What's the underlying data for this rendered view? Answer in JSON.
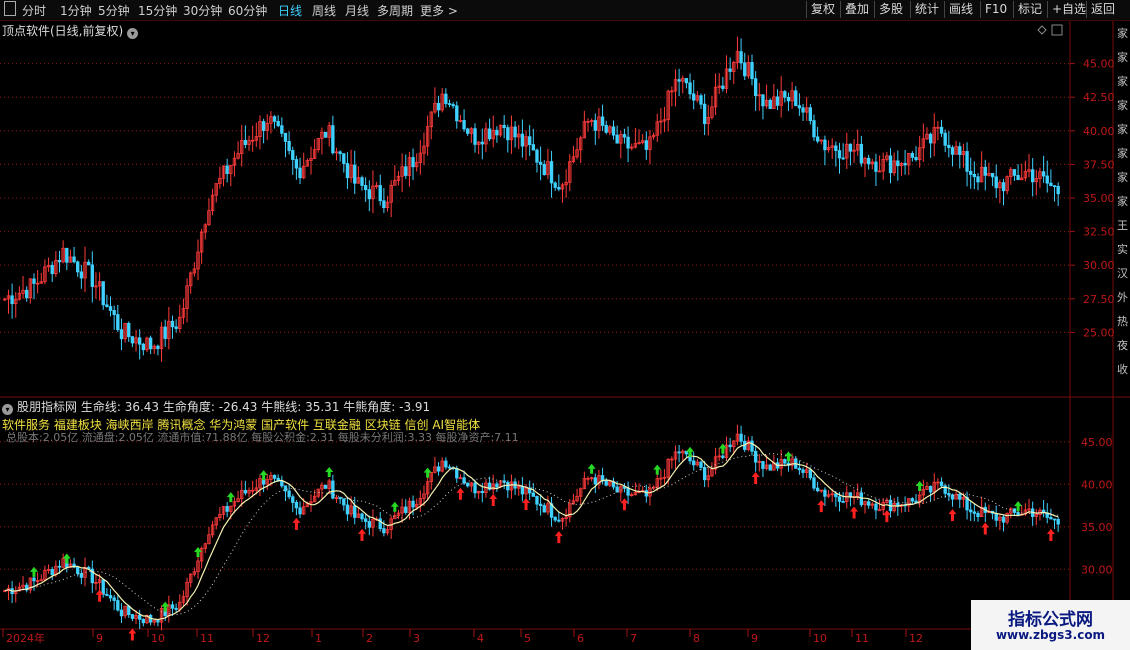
{
  "toolbar": {
    "periods": [
      "分时",
      "1分钟",
      "5分钟",
      "15分钟",
      "30分钟",
      "60分钟",
      "日线",
      "周线",
      "月线",
      "多周期",
      "更多"
    ],
    "active_period": "日线",
    "more_arrow": ">",
    "right_buttons": [
      "复权",
      "叠加",
      "多股",
      "统计",
      "画线",
      "F10",
      "标记",
      "+自选",
      "返回"
    ]
  },
  "main_chart": {
    "title": "顶点软件(日线,前复权)",
    "price_axis": [
      "45.00",
      "42.50",
      "40.00",
      "37.50",
      "35.00",
      "32.50",
      "30.00",
      "27.50",
      "25.00"
    ],
    "price_range": [
      22.2,
      47.5
    ],
    "right_strip_text": [
      "家",
      "家",
      "家",
      "家",
      "家",
      "家",
      "家",
      "家",
      "王",
      "实",
      "汉",
      "外",
      "热",
      "夜",
      "收"
    ]
  },
  "indicator": {
    "name": "股朋指标网",
    "labels": [
      {
        "label": "生命线:",
        "value": "36.43"
      },
      {
        "label": "生命角度:",
        "value": "-26.43"
      },
      {
        "label": "牛熊线:",
        "value": "35.31"
      },
      {
        "label": "牛熊角度:",
        "value": "-3.91"
      }
    ],
    "concepts": "软件服务 福建板块 海峡西岸 腾讯概念 华为鸿蒙 国产软件 互联金融 区块链 信创 AI智能体",
    "fin_info": "总股本:2.05亿 流通盘:2.05亿 流通市值:71.88亿 每股公积金:2.31 每股未分利润:3.33 每股净资产:7.11",
    "price_axis": [
      "45.00",
      "40.00",
      "35.00",
      "30.00"
    ],
    "price_range": [
      25.8,
      48.5
    ]
  },
  "time_axis": [
    "2024年",
    "9",
    "10",
    "11",
    "12",
    "1",
    "2",
    "3",
    "4",
    "5",
    "6",
    "7",
    "8",
    "9",
    "10",
    "11",
    "12"
  ],
  "watermark": {
    "title": "指标公式网",
    "url": "www.zbgs3.com"
  },
  "colors": {
    "up": "#ff3b3b",
    "down": "#3fd1ff",
    "grid": "#8a1a1a",
    "life_line": "#f6f3b0",
    "bull_bear_line": "#d0d0d0",
    "arrow_up": "#ff2020",
    "arrow_down": "#25d925"
  },
  "chart_data": {
    "type": "candlestick",
    "x": [
      "2024年",
      "9",
      "10",
      "11",
      "12",
      "1",
      "2",
      "3",
      "4",
      "5",
      "6",
      "7",
      "8",
      "9",
      "10",
      "11",
      "12"
    ],
    "close_series_estimate": [
      27.5,
      28.5,
      31.0,
      29.0,
      25.0,
      24.0,
      26.0,
      35.0,
      38.5,
      41.0,
      37.0,
      40.0,
      36.0,
      35.0,
      38.0,
      43.0,
      39.5,
      40.5,
      38.5,
      36.0,
      41.0,
      39.0,
      38.5,
      44.0,
      41.0,
      46.0,
      42.0,
      42.5,
      39.0,
      38.5,
      37.5,
      38.0,
      40.0,
      37.0,
      36.0,
      37.0,
      35.5
    ],
    "ylim": [
      22.2,
      47.5
    ],
    "series": [
      {
        "name": "生命线",
        "last": 36.43
      },
      {
        "name": "牛熊线",
        "last": 35.31
      }
    ]
  }
}
